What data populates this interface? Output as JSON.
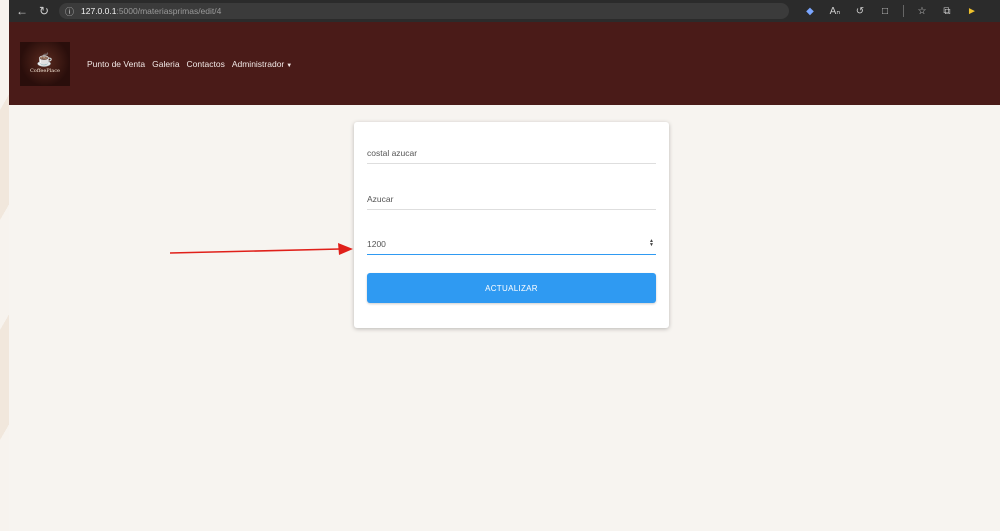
{
  "browser": {
    "url_host": "127.0.0.1",
    "url_rest": ":5000/materiasprimas/edit/4"
  },
  "nav": {
    "logo_text": "CoffeePlace",
    "links": [
      "Punto de Venta",
      "Galeria",
      "Contactos",
      "Administrador"
    ]
  },
  "form": {
    "name_value": "costal azucar",
    "ingredient_value": "Azucar",
    "quantity_value": "1200",
    "submit_label": "ACTUALIZAR"
  },
  "colors": {
    "navbar": "#4a1b18",
    "accent": "#2f9af2",
    "annotation": "#e0201a"
  }
}
